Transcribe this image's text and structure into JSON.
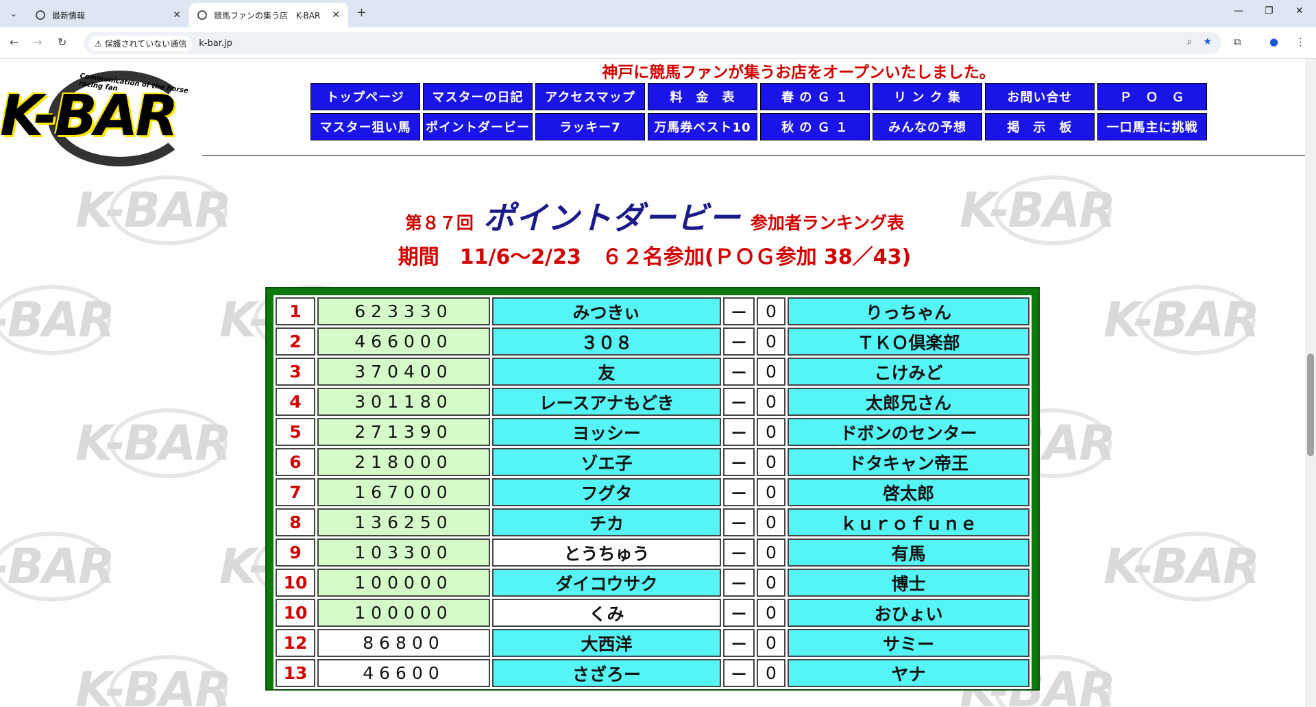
{
  "browser": {
    "tabs": [
      {
        "title": "最新情報"
      },
      {
        "title": "競馬ファンの集う店　K-BAR"
      }
    ],
    "security_label": "保護されていない通信",
    "url": "k-bar.jp"
  },
  "header": {
    "logo_text": "K-BAR",
    "logo_tagline": "Communication of the horse racing fan",
    "headline": "神戸に競馬ファンが集うお店をオープンいたしました。"
  },
  "nav": [
    {
      "label": "トップページ"
    },
    {
      "label": "マスターの日記"
    },
    {
      "label": "アクセスマップ"
    },
    {
      "label": "料　金　表"
    },
    {
      "label": "春 の Ｇ １"
    },
    {
      "label": "リ ン ク 集"
    },
    {
      "label": "お問い合せ"
    },
    {
      "label": "Ｐ　Ｏ　Ｇ"
    },
    {
      "label": "マスター狙い馬"
    },
    {
      "label": "ポイントダービー"
    },
    {
      "label": "ラッキー7"
    },
    {
      "label": "万馬券ベスト10"
    },
    {
      "label": "秋 の Ｇ １"
    },
    {
      "label": "みんなの予想"
    },
    {
      "label": "掲　示　板"
    },
    {
      "label": "一口馬主に挑戦"
    }
  ],
  "ranking": {
    "edition": "第８７回",
    "title": "ポイントダービー",
    "subtitle": "参加者ランキング表",
    "period": "期間　11/6～2/23　６２名参加(ＰＯＧ参加 38／43)",
    "rows": [
      {
        "rank": "1",
        "score": "623330",
        "name": "みつきぃ",
        "dash": "－",
        "zero": "0",
        "partner": "りっちゃん"
      },
      {
        "rank": "2",
        "score": "466000",
        "name": "３０８",
        "dash": "－",
        "zero": "0",
        "partner": "ＴＫＯ倶楽部"
      },
      {
        "rank": "3",
        "score": "370400",
        "name": "友",
        "dash": "－",
        "zero": "0",
        "partner": "こけみど"
      },
      {
        "rank": "4",
        "score": "301180",
        "name": "レースアナもどき",
        "dash": "－",
        "zero": "0",
        "partner": "太郎兄さん"
      },
      {
        "rank": "5",
        "score": "271390",
        "name": "ヨッシー",
        "dash": "－",
        "zero": "0",
        "partner": "ドボンのセンター"
      },
      {
        "rank": "6",
        "score": "218000",
        "name": "ゾエ子",
        "dash": "－",
        "zero": "0",
        "partner": "ドタキャン帝王"
      },
      {
        "rank": "7",
        "score": "167000",
        "name": "フグタ",
        "dash": "－",
        "zero": "0",
        "partner": "啓太郎"
      },
      {
        "rank": "8",
        "score": "136250",
        "name": "チカ",
        "dash": "－",
        "zero": "0",
        "partner": "ｋｕｒｏｆｕｎｅ"
      },
      {
        "rank": "9",
        "score": "103300",
        "name": "とうちゅう",
        "dash": "－",
        "zero": "0",
        "partner": "有馬"
      },
      {
        "rank": "10",
        "score": "100000",
        "name": "ダイコウサク",
        "dash": "－",
        "zero": "0",
        "partner": "博士"
      },
      {
        "rank": "10",
        "score": "100000",
        "name": "くみ",
        "dash": "－",
        "zero": "0",
        "partner": "おひょい"
      },
      {
        "rank": "12",
        "score": "86800",
        "name": "大西洋",
        "dash": "－",
        "zero": "0",
        "partner": "サミー"
      },
      {
        "rank": "13",
        "score": "46600",
        "name": "さざろー",
        "dash": "－",
        "zero": "0",
        "partner": "ヤナ"
      }
    ]
  }
}
